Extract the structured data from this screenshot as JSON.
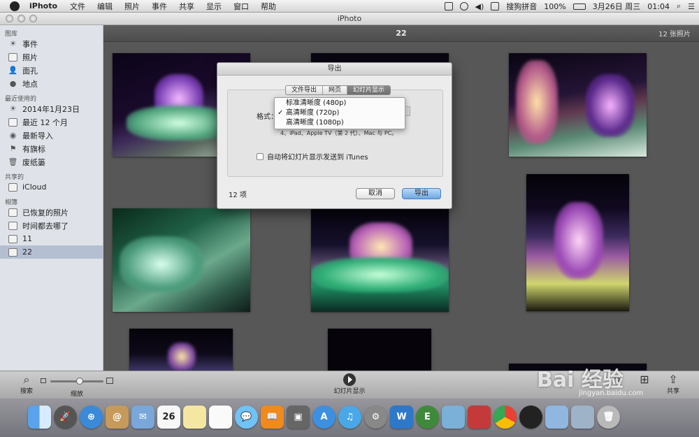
{
  "menubar": {
    "app_name": "iPhoto",
    "items": [
      "文件",
      "编辑",
      "照片",
      "事件",
      "共享",
      "显示",
      "窗口",
      "帮助"
    ],
    "input_method": "搜狗拼音",
    "battery": "100%",
    "date": "3月26日 周三",
    "time": "01:04"
  },
  "window": {
    "title": "iPhoto"
  },
  "sidebar": {
    "library_header": "图库",
    "library_items": [
      {
        "label": "事件",
        "icon": "events-icon"
      },
      {
        "label": "照片",
        "icon": "photos-icon"
      },
      {
        "label": "面孔",
        "icon": "faces-icon"
      },
      {
        "label": "地点",
        "icon": "places-icon"
      }
    ],
    "recent_header": "最近使用的",
    "recent_items": [
      {
        "label": "2014年1月23日",
        "icon": "event-icon"
      },
      {
        "label": "最近 12 个月",
        "icon": "calendar-icon"
      },
      {
        "label": "最新导入",
        "icon": "import-icon"
      },
      {
        "label": "有旗标",
        "icon": "flag-icon"
      },
      {
        "label": "废纸篓",
        "icon": "trash-icon"
      }
    ],
    "shared_header": "共享的",
    "shared_items": [
      {
        "label": "iCloud",
        "icon": "icloud-icon"
      }
    ],
    "albums_header": "相簿",
    "album_items": [
      {
        "label": "已恢复的照片",
        "icon": "album-icon"
      },
      {
        "label": "时间都去哪了",
        "icon": "album-icon"
      },
      {
        "label": "11",
        "icon": "album-icon"
      },
      {
        "label": "22",
        "icon": "album-icon",
        "selected": true
      }
    ]
  },
  "main": {
    "album_title": "22",
    "photo_count": "12 张照片"
  },
  "dialog": {
    "title": "导出",
    "tabs": [
      "文件导出",
      "网页",
      "幻灯片显示"
    ],
    "active_tab": "幻灯片显示",
    "format_label": "格式：",
    "format_options": [
      "标准清晰度 (480p)",
      "高清晰度 (720p)",
      "高清晰度 (1080p)"
    ],
    "selected_format": "高清晰度 (720p)",
    "compat_text": "4、iPad、Apple TV（第 2 代）、Mac 与 PC。",
    "itunes_checkbox": "自动将幻灯片显示发送到 iTunes",
    "item_count": "12 项",
    "cancel_label": "取消",
    "export_label": "导出"
  },
  "toolbar": {
    "search_label": "搜索",
    "zoom_label": "缩放",
    "slideshow_label": "幻灯片显示",
    "share_label": "共享",
    "zoom_level": 0.55
  },
  "watermark": {
    "text": "Bai 经验",
    "url": "jingyan.baidu.com"
  },
  "colors": {
    "selection": "#b4bfd2",
    "primary_button": "#6ea8e3",
    "main_bg": "#575757"
  }
}
